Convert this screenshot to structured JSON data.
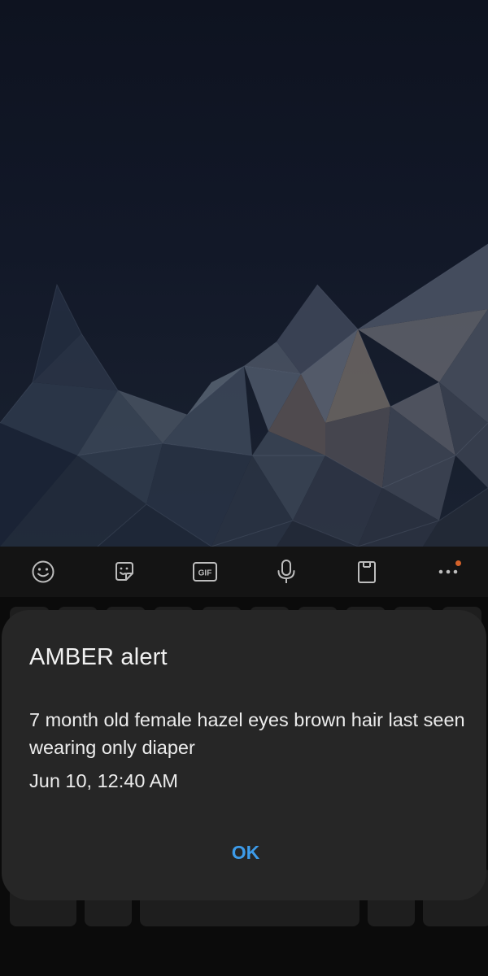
{
  "keyboard_toolbar": {
    "items": [
      {
        "icon": "emoji-icon"
      },
      {
        "icon": "sticker-icon"
      },
      {
        "icon": "gif-icon",
        "label": "GIF"
      },
      {
        "icon": "microphone-icon"
      },
      {
        "icon": "clipboard-icon"
      },
      {
        "icon": "more-options-icon",
        "badge_color": "#d4622a"
      }
    ]
  },
  "alert": {
    "title": "AMBER alert",
    "message": "7 month old female hazel eyes brown hair last seen wearing only diaper",
    "timestamp": "Jun 10, 12:40 AM",
    "ok_label": "OK",
    "accent_color": "#3d9be9"
  }
}
